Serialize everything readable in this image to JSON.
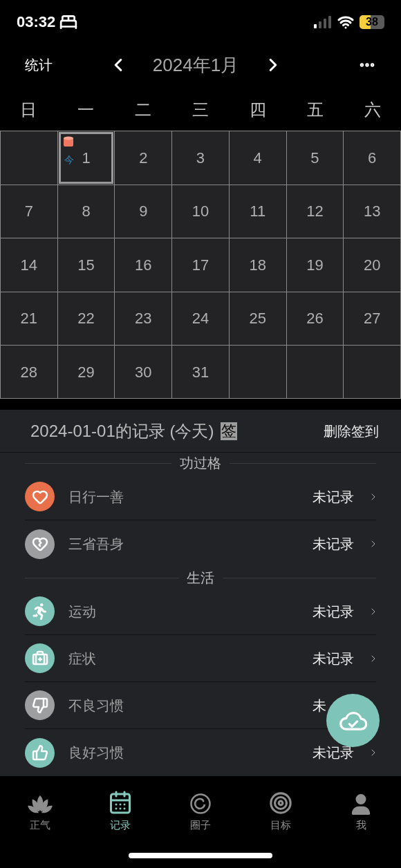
{
  "status_bar": {
    "time": "03:32",
    "battery": "38"
  },
  "header": {
    "left": "统计",
    "title": "2024年1月"
  },
  "weekdays": [
    "日",
    "一",
    "二",
    "三",
    "四",
    "五",
    "六"
  ],
  "days": [
    {
      "kind": "blank"
    },
    {
      "kind": "day",
      "day": "1",
      "selected": true,
      "today_label": "今",
      "sticker": true
    },
    {
      "kind": "day",
      "day": "2",
      "selected": false
    },
    {
      "kind": "day",
      "day": "3",
      "selected": false
    },
    {
      "kind": "day",
      "day": "4",
      "selected": false
    },
    {
      "kind": "day",
      "day": "5",
      "selected": false
    },
    {
      "kind": "day",
      "day": "6",
      "selected": false
    },
    {
      "kind": "day",
      "day": "7",
      "selected": false
    },
    {
      "kind": "day",
      "day": "8",
      "selected": false
    },
    {
      "kind": "day",
      "day": "9",
      "selected": false
    },
    {
      "kind": "day",
      "day": "10",
      "selected": false
    },
    {
      "kind": "day",
      "day": "11",
      "selected": false
    },
    {
      "kind": "day",
      "day": "12",
      "selected": false
    },
    {
      "kind": "day",
      "day": "13",
      "selected": false
    },
    {
      "kind": "day",
      "day": "14",
      "selected": false
    },
    {
      "kind": "day",
      "day": "15",
      "selected": false
    },
    {
      "kind": "day",
      "day": "16",
      "selected": false
    },
    {
      "kind": "day",
      "day": "17",
      "selected": false
    },
    {
      "kind": "day",
      "day": "18",
      "selected": false
    },
    {
      "kind": "day",
      "day": "19",
      "selected": false
    },
    {
      "kind": "day",
      "day": "20",
      "selected": false
    },
    {
      "kind": "day",
      "day": "21",
      "selected": false
    },
    {
      "kind": "day",
      "day": "22",
      "selected": false
    },
    {
      "kind": "day",
      "day": "23",
      "selected": false
    },
    {
      "kind": "day",
      "day": "24",
      "selected": false
    },
    {
      "kind": "day",
      "day": "25",
      "selected": false
    },
    {
      "kind": "day",
      "day": "26",
      "selected": false
    },
    {
      "kind": "day",
      "day": "27",
      "selected": false
    },
    {
      "kind": "day",
      "day": "28",
      "selected": false
    },
    {
      "kind": "day",
      "day": "29",
      "selected": false
    },
    {
      "kind": "day",
      "day": "30",
      "selected": false
    },
    {
      "kind": "day",
      "day": "31",
      "selected": false
    },
    {
      "kind": "blank"
    },
    {
      "kind": "blank"
    },
    {
      "kind": "blank"
    }
  ],
  "record": {
    "title": "2024-01-01的记录 (今天)",
    "badge": "签",
    "action": "删除签到",
    "sections": [
      {
        "title": "功过格",
        "items": [
          {
            "label": "日行一善",
            "status": "未记录",
            "color": "#e8704a",
            "chevron": true
          },
          {
            "label": "三省吾身",
            "status": "未记录",
            "color": "#9d9ea0",
            "chevron": true
          }
        ]
      },
      {
        "title": "生活",
        "items": [
          {
            "label": "运动",
            "status": "未记录",
            "color": "#7fc4b8",
            "chevron": true
          },
          {
            "label": "症状",
            "status": "未记录",
            "color": "#7fc4b8",
            "chevron": true
          },
          {
            "label": "不良习惯",
            "status": "未",
            "color": "#9d9ea0",
            "chevron": false
          },
          {
            "label": "良好习惯",
            "status": "未记录",
            "color": "#7fc4b8",
            "chevron": true
          }
        ]
      }
    ]
  },
  "tabs": [
    {
      "label": "正气",
      "selected": false
    },
    {
      "label": "记录",
      "selected": true
    },
    {
      "label": "圈子",
      "selected": false
    },
    {
      "label": "目标",
      "selected": false
    },
    {
      "label": "我",
      "selected": false
    }
  ]
}
